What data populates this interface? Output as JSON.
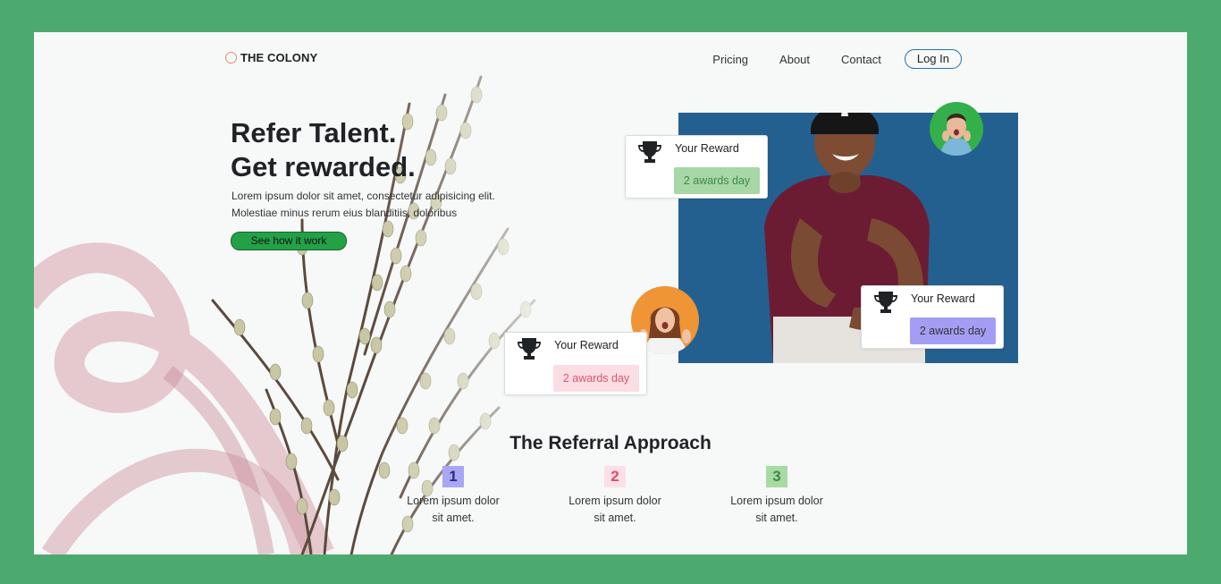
{
  "brand": {
    "name": "THE COLONY",
    "ring_color": "#e88a6c"
  },
  "nav": {
    "links": [
      "Pricing",
      "About",
      "Contact"
    ],
    "login_label": "Log In"
  },
  "hero": {
    "title_line1": "Refer Talent.",
    "title_line2": "Get rewarded.",
    "text_line1": "Lorem ipsum dolor sit amet, consectetur adipisicing elit.",
    "text_line2": "Molestiae minus rerum eius blanditiis, doloribus",
    "cta_label": "See how it work"
  },
  "rewards": [
    {
      "title": "Your Reward",
      "badge": "2 awards day",
      "icon": "trophy-icon",
      "badge_color": "#a6d7a4"
    },
    {
      "title": "Your Reward",
      "badge": "2 awards day",
      "icon": "trophy-icon",
      "badge_color": "#a39ef4"
    },
    {
      "title": "Your Reward",
      "badge": "2 awards day",
      "icon": "trophy-icon",
      "badge_color": "#fbdde4"
    }
  ],
  "referral": {
    "title": "The Referral Approach",
    "steps": [
      {
        "number": "1",
        "line1": "Lorem ipsum dolor",
        "line2": "sit amet."
      },
      {
        "number": "2",
        "line1": "Lorem ipsum dolor",
        "line2": "sit amet."
      },
      {
        "number": "3",
        "line1": "Lorem ipsum dolor",
        "line2": "sit amet."
      }
    ]
  },
  "colors": {
    "frame": "#4caa6f",
    "accent_green": "#22a146",
    "panel_blue": "#236090"
  }
}
